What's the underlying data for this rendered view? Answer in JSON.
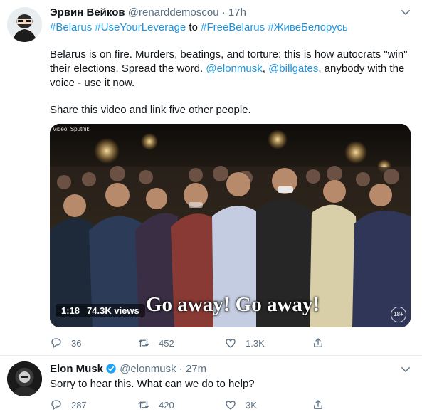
{
  "tweet1": {
    "display_name": "Эрвин Вейков",
    "handle": "@renarddemoscou",
    "separator": "·",
    "time": "17h",
    "hashtags_line": {
      "tag1": "#Belarus",
      "tag2": "#UseYourLeverage",
      "word": " to ",
      "tag3": "#FreeBelarus",
      "tag4": "#ЖивеБелорусь"
    },
    "body": {
      "part1": "Belarus is on fire. Murders, beatings, and torture: this is how autocrats \"win\" their elections. Spread the word. ",
      "mention1": "@elonmusk",
      "comma": ", ",
      "mention2": "@billgates",
      "part2": ", anybody with the voice - use it now."
    },
    "second_paragraph": "Share this video and link five other people.",
    "video": {
      "watermark": "Video: Sputnik",
      "duration": "1:18",
      "views": "74.3K views",
      "caption": "Go away! Go away!",
      "age_badge": "18+"
    },
    "actions": {
      "replies": "36",
      "retweets": "452",
      "likes": "1.3K"
    }
  },
  "tweet2": {
    "display_name": "Elon Musk",
    "handle": "@elonmusk",
    "separator": "·",
    "time": "27m",
    "body": "Sorry to hear this. What can we do to help?",
    "actions": {
      "replies": "287",
      "retweets": "420",
      "likes": "3K"
    }
  },
  "colors": {
    "link": "#1b95e0",
    "muted": "#5b7083",
    "text": "#0f1419",
    "divider": "#e6ecf0"
  },
  "icons": [
    "more-icon",
    "verified-icon",
    "reply-icon",
    "retweet-icon",
    "like-icon",
    "share-icon"
  ]
}
